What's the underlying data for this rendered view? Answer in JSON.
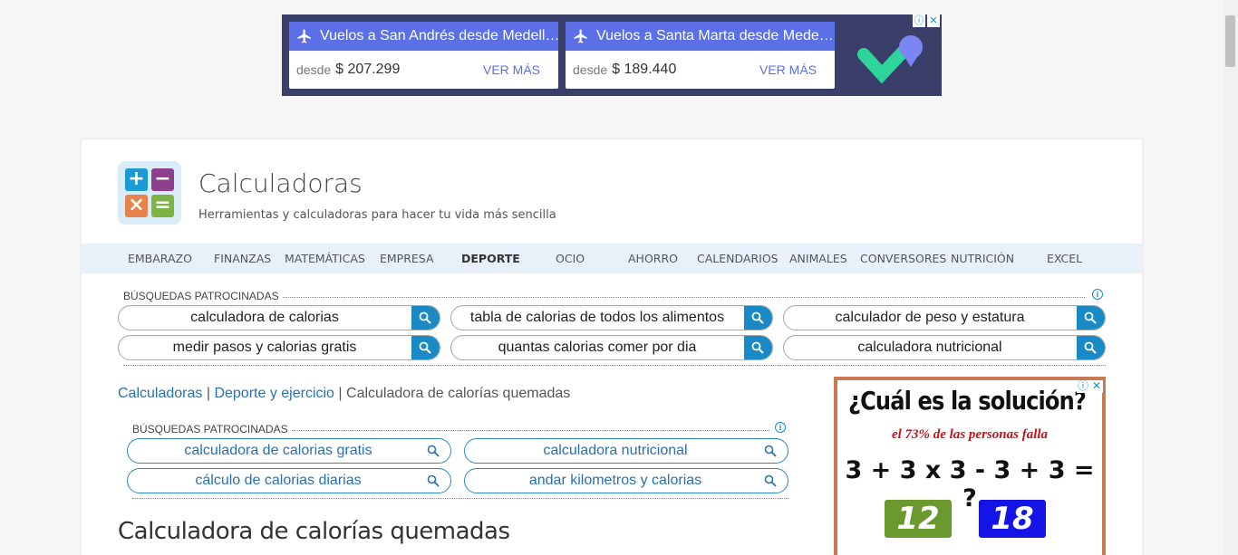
{
  "top_ad": {
    "cards": [
      {
        "title": "Vuelos a San Andrés desde Medell…",
        "desde": "desde",
        "price": "$ 207.299",
        "cta": "VER MÁS"
      },
      {
        "title": "Vuelos a Santa Marta desde Mede…",
        "desde": "desde",
        "price": "$ 189.440",
        "cta": "VER MÁS"
      }
    ],
    "info_symbol": "ⓘ",
    "close_symbol": "✕",
    "colors": {
      "background": "#3a3f6a",
      "accent": "#5b6fe6"
    }
  },
  "header": {
    "title": "Calculadoras",
    "subtitle": "Herramientas y calculadoras para hacer tu vida más sencilla",
    "logo_symbols": [
      "+",
      "−",
      "×",
      "="
    ],
    "logo_colors": [
      "#1b9ad6",
      "#8e3f8e",
      "#e7834a",
      "#7cb342"
    ]
  },
  "nav": {
    "items": [
      "EMBARAZO",
      "FINANZAS",
      "MATEMÁTICAS",
      "EMPRESA",
      "DEPORTE",
      "OCIO",
      "AHORRO",
      "CALENDARIOS",
      "ANIMALES",
      "CONVERSORES",
      "NUTRICIÓN",
      "EXCEL"
    ],
    "active": "DEPORTE"
  },
  "sponsored_top": {
    "label": "BÚSQUEDAS PATROCINADAS",
    "searches": [
      "calculadora de calorias",
      "tabla de calorias de todos los alimentos",
      "calculador de peso y estatura",
      "medir pasos y calorias gratis",
      "quantas calorias comer por dia",
      "calculadora nutricional"
    ]
  },
  "breadcrumb": {
    "home": "Calculadoras",
    "section": "Deporte y ejercicio",
    "current": "Calculadora de calorías quemadas",
    "separator": "|"
  },
  "sponsored_inner": {
    "label": "BÚSQUEDAS PATROCINADAS",
    "searches": [
      "calculadora de calorias gratis",
      "calculadora nutricional",
      "cálculo de calorias diarias",
      "andar kilometros y calorias"
    ]
  },
  "page_title": "Calculadora de calorías quemadas",
  "side_ad": {
    "question": "¿Cuál es la solución?",
    "subtitle": "el 73% de las personas falla",
    "equation": "3 + 3 x 3 - 3 + 3 = ?",
    "answers": [
      "12",
      "18"
    ],
    "answer_colors": [
      "#6a9a2e",
      "#1414e6"
    ],
    "border_color": "#c97a52"
  }
}
